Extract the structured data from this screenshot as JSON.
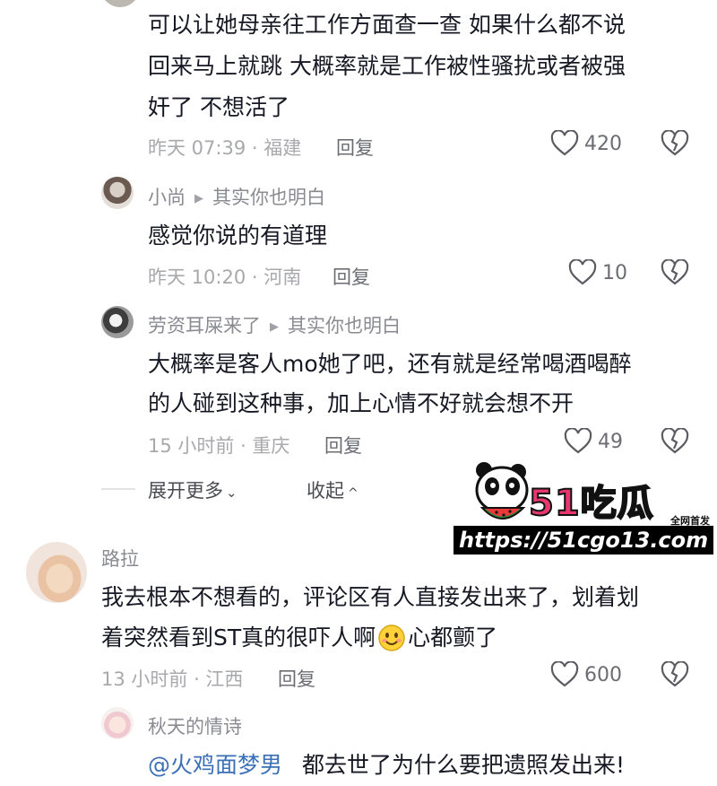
{
  "comments": [
    {
      "lines": [
        "可以让她母亲往工作方面查一查  如果什么都不说",
        "回来马上就跳 大概率就是工作被性骚扰或者被强",
        "奸了 不想活了"
      ],
      "time": "昨天 07:39 · 福建",
      "reply": "回复",
      "likes": "420"
    },
    {
      "user": "小尚",
      "reply_to": "其实你也明白",
      "lines": [
        "感觉你说的有道理"
      ],
      "time": "昨天 10:20 · 河南",
      "reply": "回复",
      "likes": "10"
    },
    {
      "user": "劳资耳屎来了",
      "reply_to": "其实你也明白",
      "lines": [
        "大概率是客人mo她了吧，还有就是经常喝酒喝醉",
        "的人碰到这种事，加上心情不好就会想不开"
      ],
      "time": "15 小时前 · 重庆",
      "reply": "回复",
      "likes": "49"
    },
    {
      "user": "路拉",
      "lines": [
        "我去根本不想看的，评论区有人直接发出来了，划着划",
        "着突然看到ST真的很吓人啊",
        "心都颤了"
      ],
      "time": "13 小时前 · 江西",
      "reply": "回复",
      "likes": "600"
    },
    {
      "user": "秋天的情诗",
      "mention": "@火鸡面梦男",
      "text": "都去世了为什么要把遗照发出来!"
    }
  ],
  "expand": {
    "more": "展开更多",
    "collapse": "收起"
  },
  "watermark": {
    "brand": "51吃瓜",
    "tag": "全网首发",
    "url": "https://51cgo13.com"
  },
  "colors": {
    "accent": "#3b6fb6",
    "meta": "#a8a9ad",
    "text": "#161823"
  }
}
